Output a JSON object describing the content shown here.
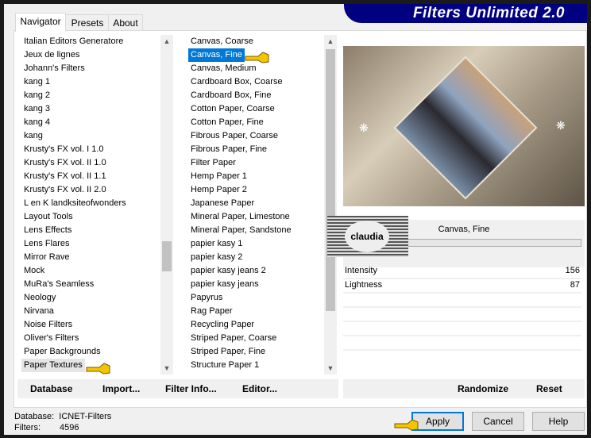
{
  "title": "Filters Unlimited 2.0",
  "tabs": [
    {
      "label": "Navigator"
    },
    {
      "label": "Presets"
    },
    {
      "label": "About"
    }
  ],
  "categories": [
    "Italian Editors Generatore",
    "Jeux de lignes",
    "Johann's Filters",
    "kang 1",
    "kang 2",
    "kang 3",
    "kang 4",
    "kang",
    "Krusty's FX vol. I 1.0",
    "Krusty's FX vol. II 1.0",
    "Krusty's FX vol. II 1.1",
    "Krusty's FX vol. II 2.0",
    "L en K landksiteofwonders",
    "Layout Tools",
    "Lens Effects",
    "Lens Flares",
    "Mirror Rave",
    "Mock",
    "MuRa's Seamless",
    "Neology",
    "Nirvana",
    "Noise Filters",
    "Oliver's Filters",
    "Paper Backgrounds",
    "Paper Textures"
  ],
  "selected_category": "Paper Textures",
  "filters": [
    "Canvas, Coarse",
    "Canvas, Fine",
    "Canvas, Medium",
    "Cardboard Box, Coarse",
    "Cardboard Box, Fine",
    "Cotton Paper, Coarse",
    "Cotton Paper, Fine",
    "Fibrous Paper, Coarse",
    "Fibrous Paper, Fine",
    "Filter Paper",
    "Hemp Paper 1",
    "Hemp Paper 2",
    "Japanese Paper",
    "Mineral Paper, Limestone",
    "Mineral Paper, Sandstone",
    "papier kasy 1",
    "papier kasy 2",
    "papier kasy jeans 2",
    "papier kasy jeans",
    "Papyrus",
    "Rag Paper",
    "Recycling Paper",
    "Striped Paper, Coarse",
    "Striped Paper, Fine",
    "Structure Paper 1"
  ],
  "selected_filter": "Canvas, Fine",
  "filter_name": "Canvas, Fine",
  "watermark": "claudia",
  "params": [
    {
      "label": "Intensity",
      "value": "156"
    },
    {
      "label": "Lightness",
      "value": "87"
    }
  ],
  "buttons": {
    "database": "Database",
    "import": "Import...",
    "filter_info": "Filter Info...",
    "editor": "Editor...",
    "randomize": "Randomize",
    "reset": "Reset",
    "apply": "Apply",
    "cancel": "Cancel",
    "help": "Help"
  },
  "status": {
    "database_label": "Database:",
    "database_value": "ICNET-Filters",
    "filters_label": "Filters:",
    "filters_value": "4596"
  },
  "colors": {
    "banner": "#000080",
    "selection": "#0078d7",
    "pointer_hand": "#f5c400"
  }
}
